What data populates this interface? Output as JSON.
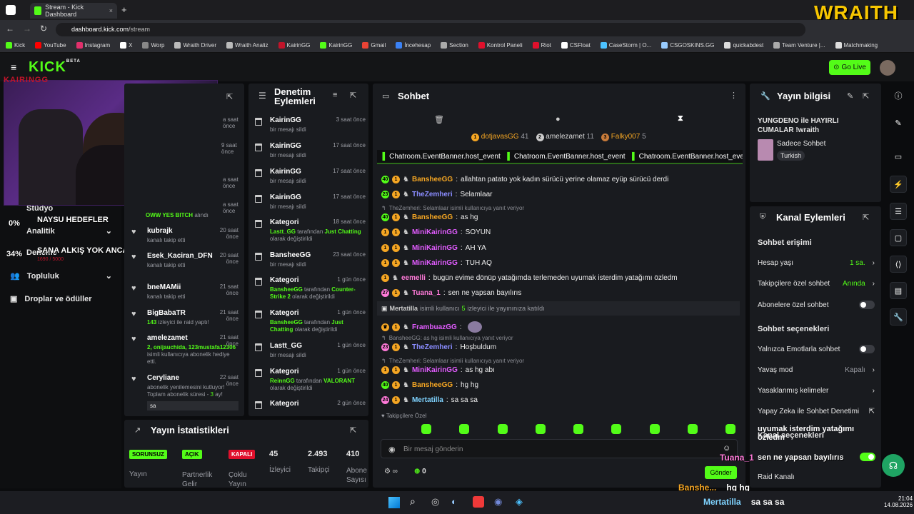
{
  "browser": {
    "tab_title": "Stream - Kick Dashboard",
    "url_host": "dashboard.kick.com",
    "url_path": "/stream",
    "bookmarks": [
      "Kick",
      "YouTube",
      "Instagram",
      "X",
      "Worp",
      "Wraith Driver",
      "Wraith Analiz",
      "KairinGG",
      "KairinGG",
      "Gmail",
      "İncehesap",
      "Section",
      "Kontrol Paneli",
      "Riot",
      "CSFloat",
      "CaseStorm | O...",
      "CSGOSKINS.GG",
      "quickabdest",
      "Team Venture |...",
      "Matchmaking"
    ]
  },
  "overlay": {
    "brand": "WRAITH",
    "cam_name": "KAIRINGG",
    "goal1_pct": "0%",
    "goal1_label": "NAYSU HEDEFLER",
    "goal2_pct": "34%",
    "goal2_label": "SANA ALKIŞ YOK ANCA KICK",
    "goal2_sub": "1690 / 5000"
  },
  "header": {
    "logo": "KICK",
    "logo_badge": "BETA",
    "go_live": "Go Live"
  },
  "sidebar": {
    "items": [
      "Stüdyo",
      "Analitik",
      "Deneme",
      "Topluluk",
      "Droplar ve ödüller"
    ]
  },
  "activity": {
    "first_text": "OWW YES BITCH",
    "first_suffix": "alındı",
    "items": [
      {
        "time1": "a saat önce"
      },
      {
        "time2": "9 saat önce"
      },
      {
        "time3": "a saat önce"
      },
      {
        "time4": "a saat önce"
      },
      {
        "time5": "a saat önce"
      }
    ],
    "entries": [
      {
        "name": "kubrajk",
        "time": "20 saat önce",
        "sub": "kanalı takip etti"
      },
      {
        "name": "Esek_Kaciran_DFN",
        "time": "20 saat önce",
        "sub": "kanalı takip etti"
      },
      {
        "name": "bneMAMii",
        "time": "21 saat önce",
        "sub": "kanalı takip etti"
      },
      {
        "name": "BigBabaTR",
        "time": "21 saat önce",
        "hl": "143",
        "sub": "izleyici ile raid yaptı!"
      },
      {
        "name": "amelezamet",
        "time": "21 saat önce",
        "hl": "2, onijauchida, 123mustafa12306",
        "sub": "isimli kullanıcıya abonelik hediye etti."
      },
      {
        "name": "Ceryliane",
        "time": "22 saat önce",
        "sub": "abonelik yenilemesini kutluyor! Toplam abonelik süresi -",
        "hl": "3",
        "sub2": "ay!",
        "msg": "sa"
      }
    ]
  },
  "moderation": {
    "title": "Denetim Eylemleri",
    "items": [
      {
        "name": "KairinGG",
        "time": "3 saat önce",
        "sub": "bir mesajı sildi"
      },
      {
        "name": "KairinGG",
        "time": "17 saat önce",
        "sub": "bir mesajı sildi"
      },
      {
        "name": "KairinGG",
        "time": "17 saat önce",
        "sub": "bir mesajı sildi"
      },
      {
        "name": "KairinGG",
        "time": "17 saat önce",
        "sub": "bir mesajı sildi"
      },
      {
        "name": "Kategori",
        "time": "18 saat önce",
        "hl": "Lastt_GG",
        "mid": "tarafından",
        "hl2": "Just Chatting",
        "sub": "olarak değiştirildi"
      },
      {
        "name": "BansheeGG",
        "time": "23 saat önce",
        "sub": "bir mesajı sildi"
      },
      {
        "name": "Kategori",
        "time": "1 gün önce",
        "hl": "BansheeGG",
        "mid": "tarafından",
        "hl2": "Counter-Strike 2",
        "sub": "olarak değiştirildi"
      },
      {
        "name": "Kategori",
        "time": "1 gün önce",
        "hl": "BansheeGG",
        "mid": "tarafından",
        "hl2": "Just Chatting",
        "sub": "olarak değiştirildi"
      },
      {
        "name": "Lastt_GG",
        "time": "1 gün önce",
        "sub": "bir mesajı sildi"
      },
      {
        "name": "Kategori",
        "time": "1 gün önce",
        "hl": "ReinnGG",
        "mid": "tarafından",
        "hl2": "VALORANT",
        "sub": "olarak değiştirildi"
      },
      {
        "name": "Kategori",
        "time": "2 gün önce",
        "sub": ""
      }
    ]
  },
  "chat": {
    "title": "Sohbet",
    "top_gifters": [
      {
        "name": "dotjavasGG",
        "count": "41"
      },
      {
        "name": "amelezamet",
        "count": "11"
      },
      {
        "name": "Falky007",
        "count": "5"
      }
    ],
    "banner": "Chatroom.EventBanner.host_event",
    "messages": [
      {
        "user": "BansheeGG",
        "color": "#f5a623",
        "text": "allahtan patato yok kadın sürücü yerine olamaz eyüp sürücü derdi"
      },
      {
        "user": "TheZemheri",
        "color": "#8a8cff",
        "text": "Selamlaar"
      },
      {
        "user": "BansheeGG",
        "color": "#f5a623",
        "text": "as hg",
        "reply": "TheZemheri: Selamlaar isimli kullanıcıya yanıt veriyor"
      },
      {
        "user": "MiniKairinGG",
        "color": "#e25cff",
        "text": "SOYUN"
      },
      {
        "user": "MiniKairinGG",
        "color": "#e25cff",
        "text": "AH YA"
      },
      {
        "user": "MiniKairinGG",
        "color": "#e25cff",
        "text": "TUH AQ"
      },
      {
        "user": "eemelli",
        "color": "#ff7ad9",
        "text": "bugün evime dönüp yatağımda terlemeden uyumak isterdim yatağımı özledm"
      },
      {
        "user": "Tuana_1",
        "color": "#ff7ad9",
        "text": "sen ne yapsan bayılırıs"
      },
      {
        "user": "FrambuazGG",
        "color": "#e25cff",
        "text": ""
      },
      {
        "user": "TheZemheri",
        "color": "#8a8cff",
        "text": "Hoşbuldum",
        "reply": "BansheeGG: as hg isimli kullanıcıya yanıt veriyor"
      },
      {
        "user": "MiniKairinGG",
        "color": "#e25cff",
        "text": "as hg abı",
        "reply": "TheZemheri: Selamlaar isimli kullanıcıya yanıt veriyor"
      },
      {
        "user": "BansheeGG",
        "color": "#f5a623",
        "text": "hg hg"
      },
      {
        "user": "Mertatilla",
        "color": "#7fd3ff",
        "text": "sa sa sa"
      }
    ],
    "host_notice_user": "Mertatilla",
    "host_notice_pre": "isimli kullanıcı",
    "host_notice_count": "5",
    "host_notice_post": "izleyici ile yayınınıza katıldı",
    "followers_only": "Takipçilere Özel",
    "input_placeholder": "Bir mesaj gönderin",
    "points": "0"
  },
  "stream_info": {
    "title": "Yayın bilgisi",
    "stream_title": "YUNGDENO ile HAYIRLI CUMALAR !wraith",
    "category": "Sadece Sohbet",
    "language": "Turkish"
  },
  "channel_actions": {
    "title": "Kanal Eylemleri",
    "chat_access": "Sohbet erişimi",
    "account_age_label": "Hesap yaşı",
    "account_age_value": "1 sa.",
    "followers_chat_label": "Takipçilere özel sohbet",
    "followers_chat_value": "Anında",
    "subs_chat_label": "Abonelere özel sohbet",
    "chat_options": "Sohbet seçenekleri",
    "emote_only": "Yalnızca Emotlarla sohbet",
    "slow_mode_label": "Yavaş mod",
    "slow_mode_value": "Kapalı",
    "banned_words": "Yasaklanmış kelimeler",
    "ai_moderation": "Yapay Zeka ile Sohbet Denetimi",
    "channel_options": "Kanal seçenekleri",
    "raid_channel": "Raid Kanalı",
    "overlay_msg": "uyumak isterdim yatağımı özledm",
    "overlay_msg2": "sen ne yapsan bayılırıs",
    "overlay_user": "Tuana_1"
  },
  "stats": {
    "title": "Yayın İstatistikleri",
    "tag1": "SORUNSUZ",
    "tag1_label": "Yayın",
    "tag2": "AÇIK",
    "tag2_label": "Partnerlik Gelir",
    "tag3": "KAPALI",
    "tag3_label": "Çoklu Yayın",
    "viewers": "45",
    "viewers_label": "İzleyici",
    "followers": "2.493",
    "followers_label": "Takipçi",
    "subs": "410",
    "subs_label": "Abone Sayısı"
  },
  "overlay_chat": [
    {
      "user": "Banshe...",
      "text": "hg hg"
    },
    {
      "user": "Mertatilla",
      "text": "sa sa sa"
    }
  ],
  "taskbar": {
    "time": "21:04",
    "date": "14.08.2026"
  }
}
